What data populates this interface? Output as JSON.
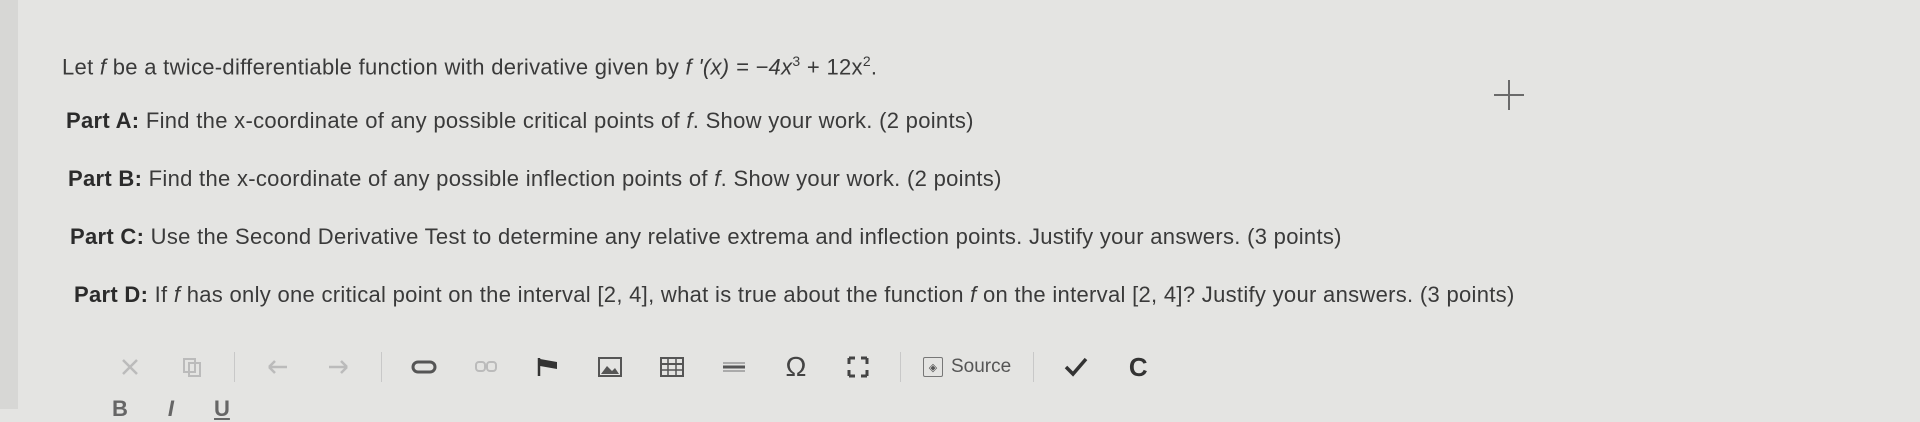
{
  "question": {
    "intro_a": "Let ",
    "intro_f": "f",
    "intro_b": " be a twice-differentiable function with derivative given by ",
    "intro_fx": "f '(x) = −4x",
    "intro_exp3": "3",
    "intro_plus": " + 12x",
    "intro_exp2": "2",
    "intro_end": ".",
    "parts": [
      {
        "label": "Part A:",
        "text": " Find the x-coordinate of any possible critical points of ",
        "f": "f",
        "tail": ". Show your work. (2 points)"
      },
      {
        "label": "Part B:",
        "text": " Find the x-coordinate of any possible inflection points of ",
        "f": "f",
        "tail": ". Show your work. (2 points)"
      },
      {
        "label": "Part C:",
        "text": " Use the Second Derivative Test to determine any relative extrema and inflection points. Justify your answers. (3 points)"
      },
      {
        "label": "Part D:",
        "text": " If ",
        "f": "f",
        "mid": " has only one critical point on the interval [2, 4], what is true about the function ",
        "f2": "f",
        "tail": " on the interval [2, 4]? Justify your answers. (3 points)"
      }
    ]
  },
  "toolbar": {
    "source_label": "Source",
    "icons": [
      "cut-icon",
      "copy-icon",
      "undo-icon",
      "redo-icon",
      "link-icon",
      "unlink-icon",
      "flag-icon",
      "image-icon",
      "table-icon",
      "horizontal-line-icon",
      "omega-icon",
      "maximize-icon",
      "source-icon",
      "check-icon",
      "c-icon"
    ],
    "row2": [
      "B",
      "I",
      "U"
    ]
  }
}
